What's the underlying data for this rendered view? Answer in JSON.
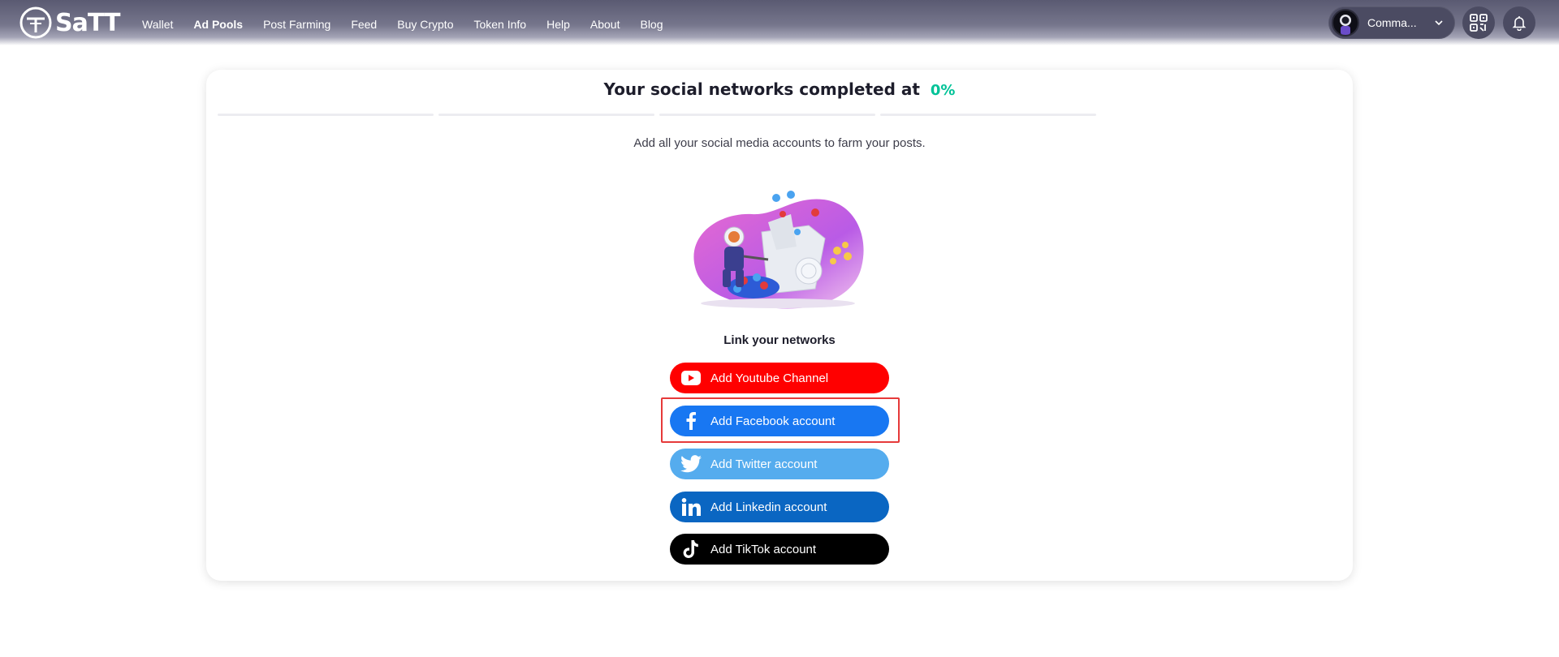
{
  "brand": {
    "name": "SaTT"
  },
  "nav": {
    "items": [
      {
        "label": "Wallet",
        "active": false
      },
      {
        "label": "Ad Pools",
        "active": true
      },
      {
        "label": "Post Farming",
        "active": false
      },
      {
        "label": "Feed",
        "active": false
      },
      {
        "label": "Buy Crypto",
        "active": false
      },
      {
        "label": "Token Info",
        "active": false
      },
      {
        "label": "Help",
        "active": false
      },
      {
        "label": "About",
        "active": false
      },
      {
        "label": "Blog",
        "active": false
      }
    ]
  },
  "account": {
    "name": "Comma..."
  },
  "progress": {
    "heading": "Your social networks completed at",
    "percent_label": "0%",
    "percent": 0
  },
  "subtitle": "Add all your social media accounts to farm your posts.",
  "link_title": "Link your networks",
  "buttons": {
    "youtube": {
      "label": "Add Youtube Channel",
      "icon": "youtube-icon",
      "color": "#ff0000"
    },
    "facebook": {
      "label": "Add Facebook account",
      "icon": "facebook-icon",
      "color": "#1877f2"
    },
    "twitter": {
      "label": "Add Twitter account",
      "icon": "twitter-icon",
      "color": "#55acee"
    },
    "linkedin": {
      "label": "Add Linkedin account",
      "icon": "linkedin-icon",
      "color": "#0a66c2"
    },
    "tiktok": {
      "label": "Add TikTok account",
      "icon": "tiktok-icon",
      "color": "#000000"
    }
  },
  "colors": {
    "accent_green": "#00c297",
    "highlight": "#e63a3a"
  }
}
